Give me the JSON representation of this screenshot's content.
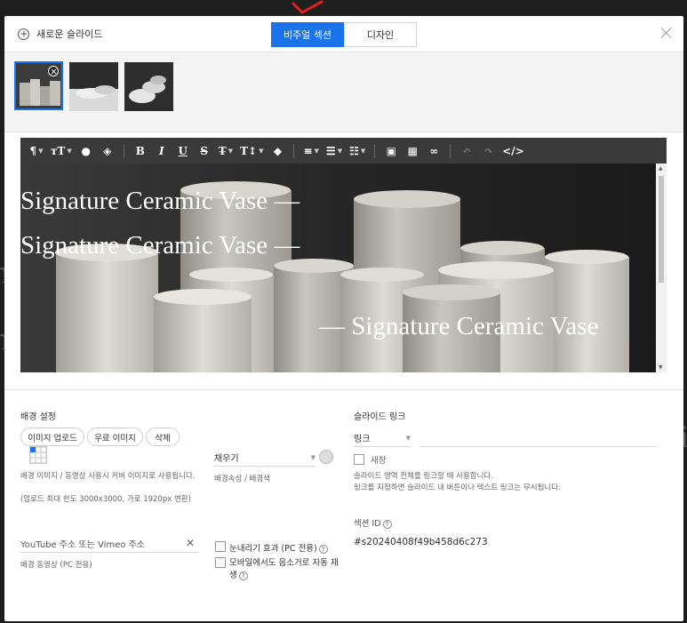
{
  "header": {
    "new_slide_label": "새로운 슬라이드",
    "tabs": [
      {
        "label": "비주얼 섹션",
        "active": true
      },
      {
        "label": "디자인",
        "active": false
      }
    ]
  },
  "editor": {
    "headline_1": "Signature Ceramic Vase —",
    "headline_2": "Signature Ceramic Vase —",
    "headline_3": "— Signature Ceramic Vase"
  },
  "background": {
    "title": "배경 설정",
    "upload_button": "이미지 업로드",
    "free_image_button": "무료 이미지",
    "delete_button": "삭제",
    "help_1": "배경 이미지 / 동영상 사용시 커버 이미지로 사용됩니다.",
    "help_2": "(업로드 최대 한도 3000x3000, 가로 1920px 변환)",
    "fill_value": "채우기",
    "fill_help": "배경속성 / 배경색",
    "video_placeholder": "YouTube 주소 또는 Vimeo 주소",
    "video_help": "배경 동영상 (PC 전용)",
    "snow_effect": "눈내리기 효과 (PC 전용)",
    "mobile_autoplay": "모바일에서도 음소거로 자동 재생"
  },
  "slide_link": {
    "title": "슬라이드 링크",
    "link_type": "링크",
    "new_window": "새창",
    "help_1": "슬라이드 영역 전체를 링크할 때 사용합니다.",
    "help_2": "링크를 지정하면 슬라이드 내 버튼이나 텍스트 링크는 무시됩니다.",
    "section_id_label": "섹션 ID",
    "section_id_value": "#s20240408f49b458d6c273"
  },
  "icons": [
    "plus-circle-icon",
    "close-icon",
    "paragraph-icon",
    "font-size-icon",
    "text-color-icon",
    "fill-color-icon",
    "bold-icon",
    "italic-icon",
    "underline-icon",
    "strikethrough-icon",
    "clear-format-icon",
    "line-height-icon",
    "eraser-icon",
    "align-icon",
    "ordered-list-icon",
    "unordered-list-icon",
    "image-icon",
    "table-icon",
    "link-icon",
    "undo-icon",
    "redo-icon",
    "code-view-icon",
    "help-icon"
  ],
  "colors": {
    "accent": "#1a73e8",
    "toolbar": "#3a3a3a"
  }
}
